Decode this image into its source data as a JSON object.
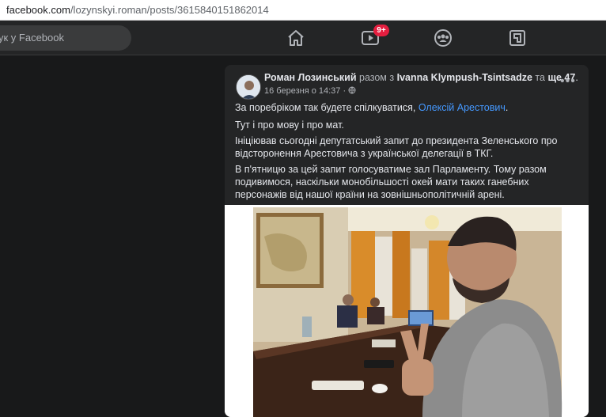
{
  "browser": {
    "url_host": "facebook.com",
    "url_path": "/lozynskyi.roman/posts/3615840151862014"
  },
  "topnav": {
    "search_placeholder": "ук у Facebook",
    "icons": [
      "home-icon",
      "video-icon",
      "groups-icon",
      "gaming-icon"
    ],
    "video_badge": "9+",
    "colors": {
      "badge": "#e41e3f",
      "background": "#242526"
    }
  },
  "post": {
    "author": "Роман Лозинський",
    "with_text": "разом з",
    "tagged": "Ivanna Klympush-Tsintsadze",
    "and_text": "та",
    "others": "ще 47",
    "timestamp": "16 березня о 14:37",
    "privacy_icon": "public-globe-icon",
    "more_label": "•••",
    "p1_before": "За поребріком так будете спілкуватися, ",
    "p1_link": "Олексій Арестович",
    "p1_after": ".",
    "p2": "Тут і про мову і про мат.",
    "p3": "Ініціював сьогодні депутатський запит до президента Зеленського про відсторонення Арестовича з української делегації в ТКГ.",
    "p4": "В п'ятницю за цей запит голосуватиме зал Парламенту. Тому разом подивимося, наскільки монобільшості окей мати таких ганебних персонажів від нашої країни на зовнішньополітичній арені.",
    "link_color": "#4599ff"
  }
}
